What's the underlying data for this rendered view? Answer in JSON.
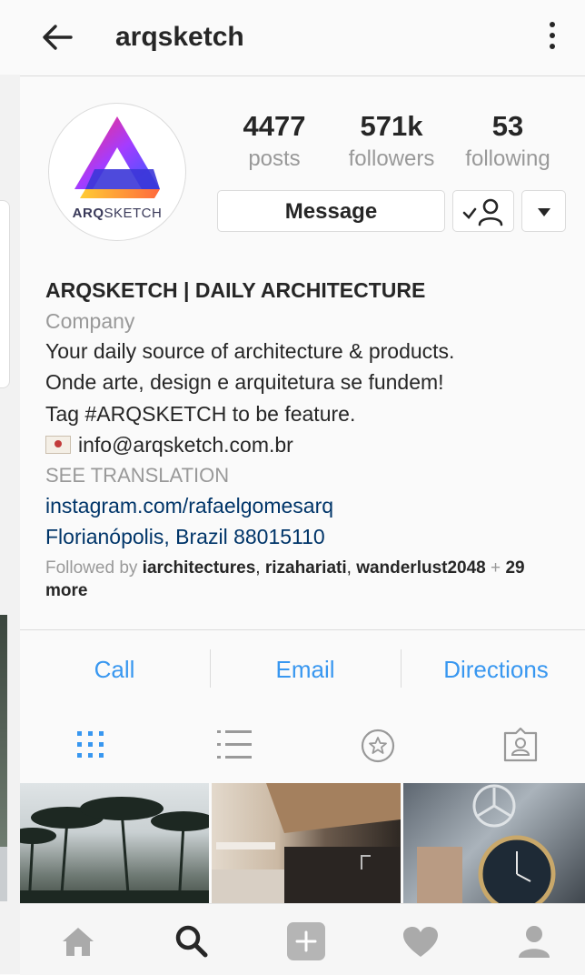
{
  "header": {
    "title": "arqsketch",
    "back_icon": "arrow-left-icon",
    "menu_icon": "more-vertical-icon"
  },
  "profile": {
    "avatar_text_bold": "ARQ",
    "avatar_text_rest": "SKETCH",
    "stats": [
      {
        "value": "4477",
        "label": "posts"
      },
      {
        "value": "571k",
        "label": "followers"
      },
      {
        "value": "53",
        "label": "following"
      }
    ],
    "message_label": "Message",
    "following_icon": "user-check-icon",
    "dropdown_icon": "caret-down-icon"
  },
  "bio": {
    "name": "ARQSKETCH | DAILY ARCHITECTURE",
    "category": "Company",
    "lines": [
      "Your daily source of architecture & products.",
      "Onde arte, design e arquitetura se fundem!",
      "Tag #ARQSKETCH to be feature."
    ],
    "email": "info@arqsketch.com.br",
    "see_translation": "SEE TRANSLATION",
    "link": "instagram.com/rafaelgomesarq",
    "location": "Florianópolis, Brazil 88015110"
  },
  "followed_by": {
    "prefix": "Followed by",
    "users": [
      "iarchitectures",
      "rizahariati",
      "wanderlust2048"
    ],
    "sep": ",",
    "plus": "+",
    "more": "29 more"
  },
  "actions": [
    "Call",
    "Email",
    "Directions"
  ],
  "tabs": [
    "grid-icon",
    "list-icon",
    "tagged-star-icon",
    "tagged-person-icon"
  ],
  "nav": [
    "home-icon",
    "search-icon",
    "add-post-icon",
    "heart-icon",
    "profile-icon"
  ],
  "colors": {
    "accent": "#3897f0",
    "link": "#003569",
    "muted": "#999999",
    "text": "#262626"
  }
}
